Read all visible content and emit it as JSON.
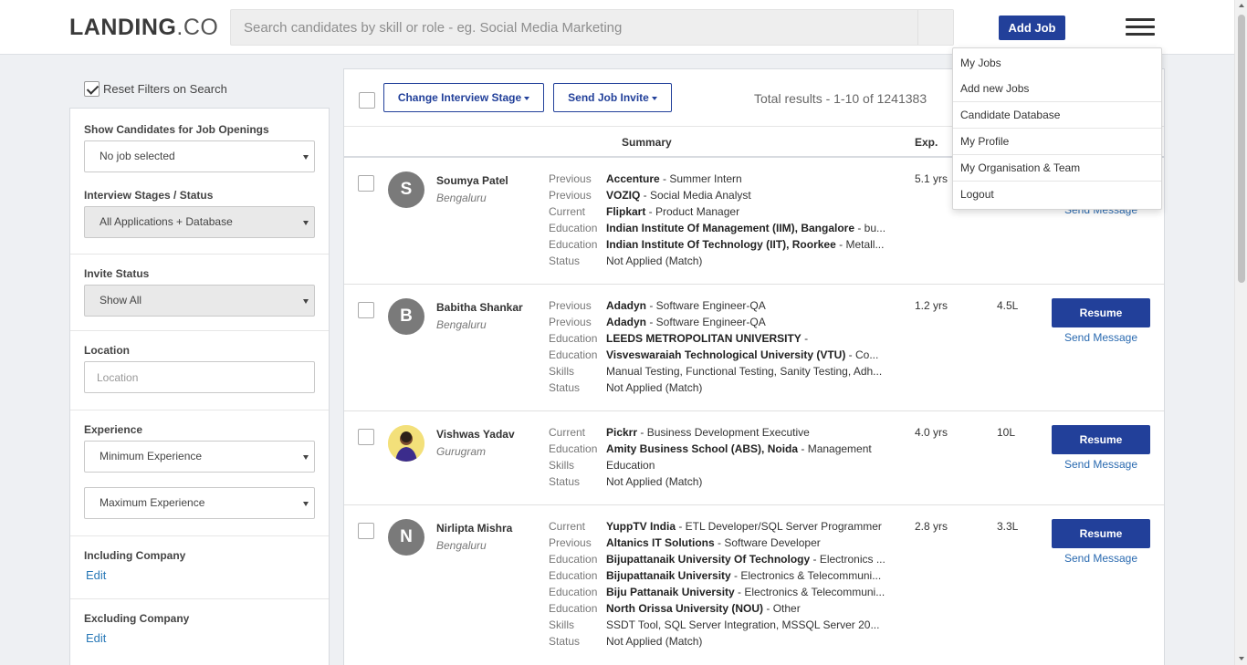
{
  "header": {
    "logo_bold": "LANDING",
    "logo_rest": ".CO",
    "search_placeholder": "Search candidates by skill or role - eg. Social Media Marketing",
    "add_job_label": "Add Job",
    "accent_color": "#22409a"
  },
  "menu": {
    "items": [
      "My Jobs",
      "Add new Jobs",
      "Candidate Database",
      "My Profile",
      "My Organisation & Team",
      "Logout"
    ]
  },
  "sidebar": {
    "reset_label": "Reset Filters on Search",
    "reset_checked": true,
    "job_openings": {
      "label": "Show Candidates for Job Openings",
      "value": "No job selected"
    },
    "interview_stages": {
      "label": "Interview Stages / Status",
      "value": "All Applications + Database"
    },
    "invite_status": {
      "label": "Invite Status",
      "value": "Show All"
    },
    "location": {
      "label": "Location",
      "placeholder": "Location"
    },
    "experience": {
      "label": "Experience",
      "min_value": "Minimum Experience",
      "max_value": "Maximum Experience"
    },
    "including_company": {
      "label": "Including Company",
      "edit": "Edit"
    },
    "excluding_company": {
      "label": "Excluding Company",
      "edit": "Edit"
    }
  },
  "toolbar": {
    "change_stage_label": "Change Interview Stage",
    "send_invite_label": "Send Job Invite",
    "total_results": "Total results  -  1-10 of 1241383"
  },
  "table_headers": {
    "summary": "Summary",
    "exp": "Exp."
  },
  "labels": {
    "resume": "Resume",
    "send_message": "Send Message"
  },
  "candidates": [
    {
      "initial": "S",
      "name": "Soumya Patel",
      "city": "Bengaluru",
      "exp": "5.1 yrs",
      "salary": "",
      "summary": [
        {
          "k": "Previous",
          "b": "Accenture",
          "r": " - Summer Intern"
        },
        {
          "k": "Previous",
          "b": "VOZIQ",
          "r": " - Social Media Analyst"
        },
        {
          "k": "Current",
          "b": "Flipkart",
          "r": " - Product Manager"
        },
        {
          "k": "Education",
          "b": "Indian Institute Of Management (IIM), Bangalore",
          "r": " - bu..."
        },
        {
          "k": "Education",
          "b": "Indian Institute Of Technology (IIT), Roorkee",
          "r": " - Metall..."
        },
        {
          "k": "Status",
          "b": "",
          "r": " Not Applied (Match)"
        }
      ]
    },
    {
      "initial": "B",
      "name": "Babitha Shankar",
      "city": "Bengaluru",
      "exp": "1.2 yrs",
      "salary": "4.5L",
      "summary": [
        {
          "k": "Previous",
          "b": "Adadyn",
          "r": " - Software Engineer-QA"
        },
        {
          "k": "Previous",
          "b": "Adadyn",
          "r": " - Software Engineer-QA"
        },
        {
          "k": "Education",
          "b": "LEEDS METROPOLITAN UNIVERSITY",
          "r": " -"
        },
        {
          "k": "Education",
          "b": "Visveswaraiah Technological University (VTU)",
          "r": " - Co..."
        },
        {
          "k": "Skills",
          "b": "",
          "r": "Manual Testing, Functional Testing, Sanity Testing, Adh..."
        },
        {
          "k": "Status",
          "b": "",
          "r": " Not Applied (Match)"
        }
      ]
    },
    {
      "initial": "V",
      "name": "Vishwas Yadav",
      "city": "Gurugram",
      "exp": "4.0 yrs",
      "salary": "10L",
      "summary": [
        {
          "k": "Current",
          "b": "Pickrr",
          "r": " - Business Development Executive"
        },
        {
          "k": "Education",
          "b": "Amity Business School (ABS), Noida",
          "r": " - Management"
        },
        {
          "k": "Skills",
          "b": "",
          "r": "Education"
        },
        {
          "k": "Status",
          "b": "",
          "r": " Not Applied (Match)"
        }
      ]
    },
    {
      "initial": "N",
      "name": "Nirlipta Mishra",
      "city": "Bengaluru",
      "exp": "2.8 yrs",
      "salary": "3.3L",
      "summary": [
        {
          "k": "Current",
          "b": "YuppTV India",
          "r": " - ETL Developer/SQL Server Programmer"
        },
        {
          "k": "Previous",
          "b": "Altanics IT Solutions",
          "r": " - Software Developer"
        },
        {
          "k": "Education",
          "b": "Bijupattanaik University Of Technology",
          "r": " - Electronics ..."
        },
        {
          "k": "Education",
          "b": "Bijupattanaik University",
          "r": " - Electronics & Telecommuni..."
        },
        {
          "k": "Education",
          "b": "Biju Pattanaik University",
          "r": " - Electronics & Telecommuni..."
        },
        {
          "k": "Education",
          "b": "North Orissa University (NOU)",
          "r": " - Other"
        },
        {
          "k": "Skills",
          "b": "",
          "r": "SSDT Tool, SQL Server Integration, MSSQL Server 20..."
        },
        {
          "k": "Status",
          "b": "",
          "r": " Not Applied (Match)"
        }
      ]
    }
  ]
}
